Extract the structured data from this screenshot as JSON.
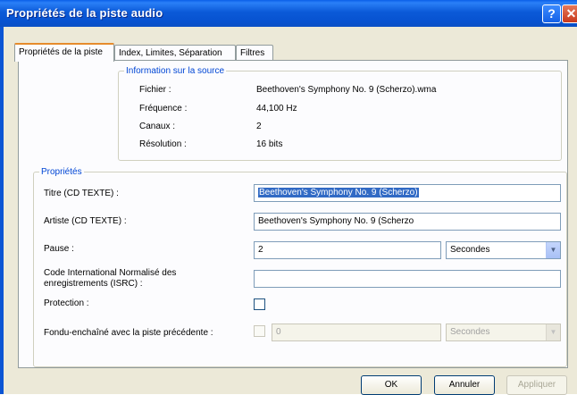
{
  "window": {
    "title": "Propriétés de la piste audio",
    "help_glyph": "?",
    "close_glyph": "✕"
  },
  "tabs": [
    {
      "label": "Propriétés de la piste"
    },
    {
      "label": "Index, Limites, Séparation"
    },
    {
      "label": "Filtres"
    }
  ],
  "source": {
    "legend": "Information sur la source",
    "fichier_label": "Fichier :",
    "fichier_value": "Beethoven's Symphony No. 9 (Scherzo).wma",
    "frequence_label": "Fréquence :",
    "frequence_value": "44,100 Hz",
    "canaux_label": "Canaux :",
    "canaux_value": "2",
    "resolution_label": "Résolution :",
    "resolution_value": "16 bits"
  },
  "props": {
    "legend": "Propriétés",
    "titre_label": "Titre (CD TEXTE) :",
    "titre_value": "Beethoven's Symphony No. 9 (Scherzo)",
    "artiste_label": "Artiste (CD TEXTE) :",
    "artiste_value": "Beethoven's Symphony No. 9 (Scherzo",
    "pause_label": "Pause :",
    "pause_value": "2",
    "pause_unit": "Secondes",
    "isrc_label": "Code International Normalisé des enregistrements (ISRC) :",
    "isrc_value": "",
    "protection_label": "Protection :",
    "fondu_label": "Fondu-enchaîné avec la piste précédente :",
    "fondu_value": "0",
    "fondu_unit": "Secondes"
  },
  "buttons": {
    "ok": "OK",
    "annuler": "Annuler",
    "appliquer": "Appliquer"
  },
  "colors": {
    "accent": "#0046d5",
    "titlebar": "#0b5ad8",
    "selection": "#316ac5"
  }
}
